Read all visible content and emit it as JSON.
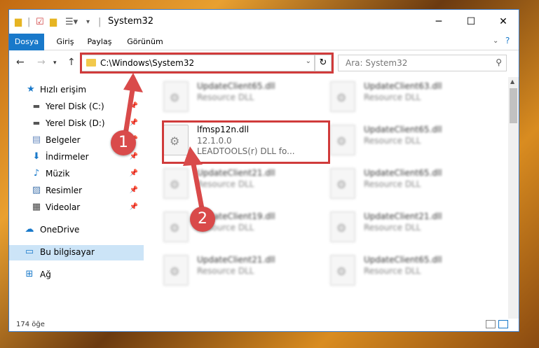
{
  "window": {
    "title": "System32"
  },
  "ribbon": {
    "tabs": [
      "Dosya",
      "Giriş",
      "Paylaş",
      "Görünüm"
    ]
  },
  "address": {
    "path": "C:\\Windows\\System32"
  },
  "search": {
    "placeholder": "Ara: System32"
  },
  "sidebar": {
    "items": [
      {
        "label": "Hızlı erişim",
        "icon": "star-icon"
      },
      {
        "label": "Yerel Disk (C:)",
        "icon": "drive-icon"
      },
      {
        "label": "Yerel Disk (D:)",
        "icon": "drive-icon"
      },
      {
        "label": "Belgeler",
        "icon": "documents-icon"
      },
      {
        "label": "İndirmeler",
        "icon": "download-icon"
      },
      {
        "label": "Müzik",
        "icon": "music-icon"
      },
      {
        "label": "Resimler",
        "icon": "pictures-icon"
      },
      {
        "label": "Videolar",
        "icon": "video-icon"
      },
      {
        "label": "OneDrive",
        "icon": "cloud-icon"
      },
      {
        "label": "Bu bilgisayar",
        "icon": "computer-icon"
      },
      {
        "label": "Ağ",
        "icon": "network-icon"
      }
    ]
  },
  "files": {
    "left": [
      {
        "name": "UpdateClient65.dll",
        "type": "Resource DLL"
      },
      {
        "name": "lfmsp12n.dll",
        "version": "12.1.0.0",
        "description": "LEADTOOLS(r) DLL fo..."
      },
      {
        "name": "UpdateClient21.dll",
        "type": "Resource DLL"
      },
      {
        "name": "UpdateClient19.dll",
        "type": "Resource DLL"
      },
      {
        "name": "UpdateClient21.dll",
        "type": "Resource DLL"
      }
    ],
    "right": [
      {
        "name": "UpdateClient63.dll",
        "type": "Resource DLL"
      },
      {
        "name": "UpdateClient65.dll",
        "type": "Resource DLL"
      },
      {
        "name": "UpdateClient65.dll",
        "type": "Resource DLL"
      },
      {
        "name": "UpdateClient21.dll",
        "type": "Resource DLL"
      },
      {
        "name": "UpdateClient65.dll",
        "type": "Resource DLL"
      }
    ]
  },
  "status": {
    "count": "174 öğe"
  },
  "annotations": {
    "badge1": "1",
    "badge2": "2"
  },
  "colors": {
    "accent": "#1979ca",
    "highlight": "#d03b3b"
  }
}
